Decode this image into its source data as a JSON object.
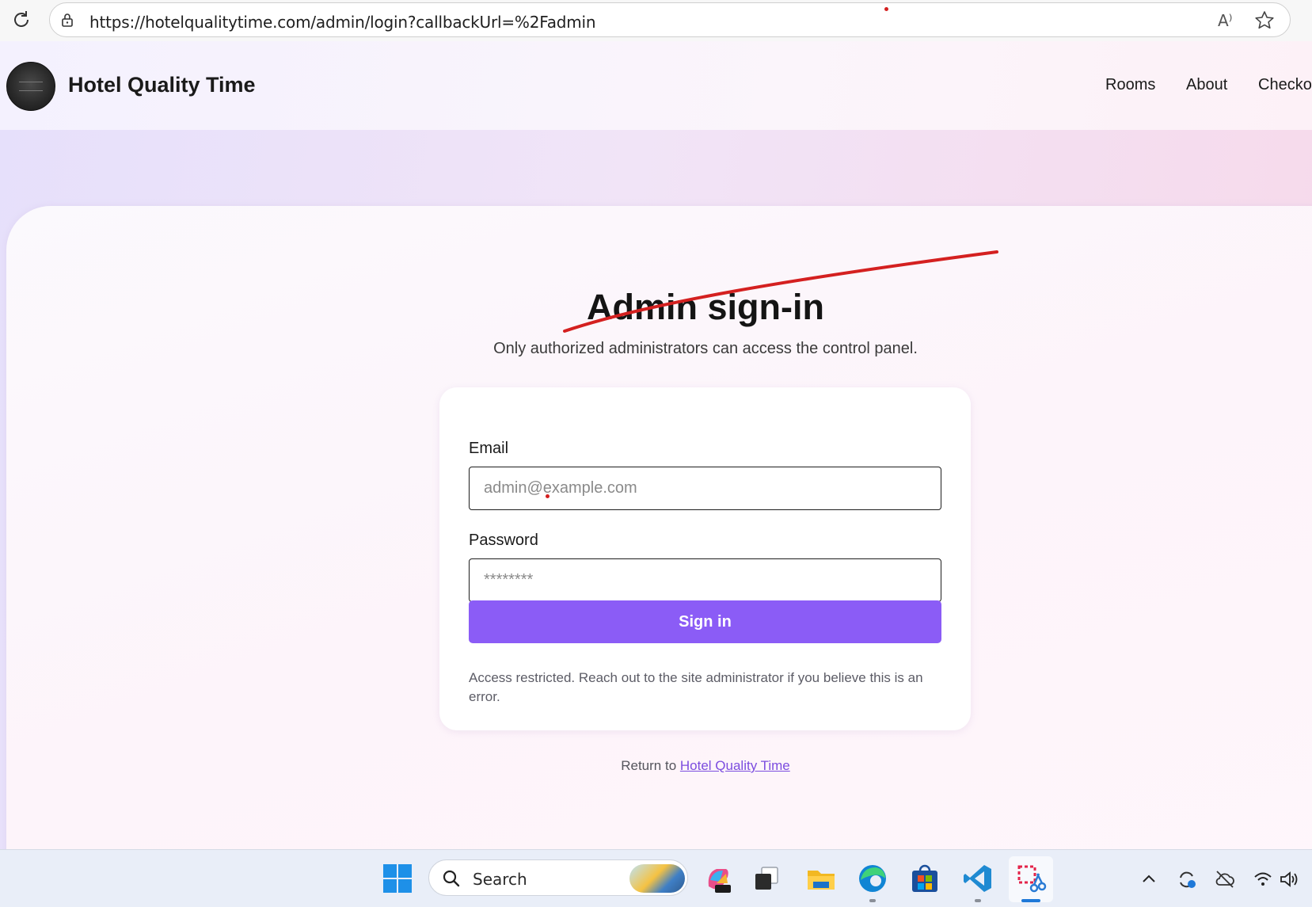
{
  "browser": {
    "url": "https://hotelqualitytime.com/admin/login?callbackUrl=%2Fadmin",
    "read_aloud_glyph": "A⁾"
  },
  "header": {
    "site_title": "Hotel Quality Time",
    "nav": [
      "Rooms",
      "About",
      "Checko"
    ]
  },
  "login": {
    "heading": "Admin sign-in",
    "subtitle": "Only authorized administrators can access the control panel.",
    "email_label": "Email",
    "email_placeholder": "admin@example.com",
    "password_label": "Password",
    "password_placeholder": "********",
    "submit_label": "Sign in",
    "notice": "Access restricted. Reach out to the site administrator if you believe this is an error.",
    "return_prefix": "Return to ",
    "return_link": "Hotel Quality Time"
  },
  "taskbar": {
    "search_label": "Search"
  },
  "colors": {
    "accent": "#8b5cf6",
    "annotation": "#d42020",
    "link": "#7c4ddf"
  },
  "icons": [
    "reload-icon",
    "lock-icon",
    "read-aloud-icon",
    "star-icon",
    "windows-start-icon",
    "search-icon",
    "copilot-icon",
    "task-view-icon",
    "file-explorer-icon",
    "edge-icon",
    "store-icon",
    "vscode-icon",
    "snipping-tool-icon",
    "chevron-up-icon",
    "sync-icon",
    "cloud-off-icon",
    "wifi-icon",
    "volume-icon"
  ]
}
